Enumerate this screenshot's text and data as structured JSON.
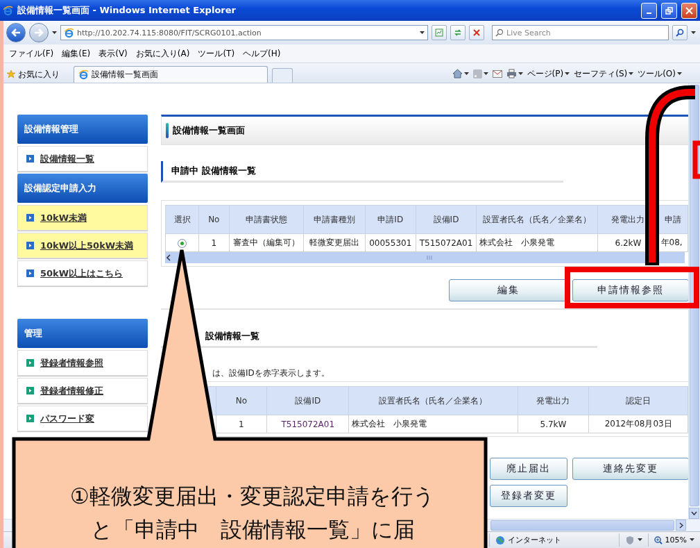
{
  "window": {
    "title": "設備情報一覧画面 - Windows Internet Explorer"
  },
  "address_bar": {
    "url": "http://10.202.74.115:8080/FIT/SCRG0101.action",
    "search_placeholder": "Live Search"
  },
  "menu": [
    "ファイル(F)",
    "編集(E)",
    "表示(V)",
    "お気に入り(A)",
    "ツール(T)",
    "ヘルプ(H)"
  ],
  "favorites_bar": {
    "favorites": "お気に入り",
    "tab": "設備情報一覧画面",
    "commands": [
      "ページ(P)",
      "セーフティ(S)",
      "ツール(O)"
    ]
  },
  "sidebar": [
    {
      "title": "設備情報管理",
      "color": "#2a6cc8",
      "items": [
        {
          "label": "設備情報一覧",
          "highlighted": false
        }
      ]
    },
    {
      "title": "設備認定申請入力",
      "color": "#2a6cc8",
      "items": [
        {
          "label": "10kW未満",
          "highlighted": true
        },
        {
          "label": "10kW以上50kW未満",
          "highlighted": true
        },
        {
          "label": "50kW以上はこちら",
          "highlighted": false
        }
      ]
    },
    {
      "title": "管理",
      "color": "#16a07c",
      "items": [
        {
          "label": "登録者情報参照",
          "highlighted": false
        },
        {
          "label": "登録者情報修正",
          "highlighted": false
        },
        {
          "label": "パスワード変",
          "highlighted": false
        }
      ]
    }
  ],
  "page_title": "設備情報一覧画面",
  "pending": {
    "heading": "申請中 設備情報一覧",
    "columns": [
      "選択",
      "No",
      "申請書状態",
      "申請書種別",
      "申請ID",
      "設備ID",
      "設置者氏名（氏名／企業名）",
      "発電出力",
      "申請"
    ],
    "rows": [
      {
        "selected": true,
        "cells": [
          "",
          "1",
          "審査中（編集可）",
          "軽微変更届出",
          "00055301",
          "T515072A01",
          "株式会社　小泉発電",
          "6.2kW",
          "年08,"
        ]
      }
    ],
    "buttons": [
      "編集",
      "申請情報参照"
    ]
  },
  "certified": {
    "heading": "設備情報一覧",
    "note": "は、設備IDを赤字表示します。",
    "columns": [
      "No",
      "設備ID",
      "設置者氏名（氏名／企業名）",
      "発電出力",
      "認定日"
    ],
    "rows": [
      [
        "1",
        "T515072A01",
        "株式会社　小泉発電",
        "5.7kW",
        "2012年08月03日"
      ]
    ],
    "buttons": [
      "廃止届出",
      "連絡先変更",
      "登録者変更"
    ]
  },
  "status_bar": {
    "zone": "インターネット",
    "zoom": "105%"
  },
  "callout": {
    "lines": [
      "①軽微変更届出・変更認定申請を行う",
      "と「申請中　設備情報一覧」に届"
    ]
  }
}
